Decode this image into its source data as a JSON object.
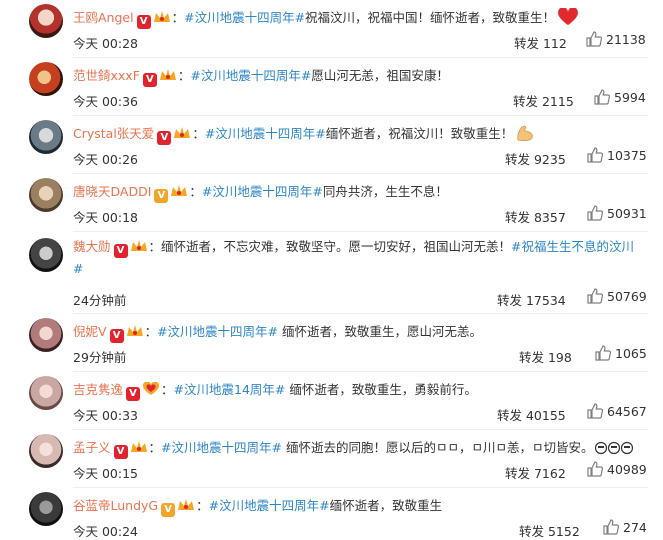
{
  "comments": [
    {
      "name": "王鸥Angel",
      "badge": "red",
      "topic": "#汶川地震十四周年#",
      "text": "祝福汶川，祝福中国！缅怀逝者，致敬重生！",
      "emoji": "heart",
      "time": "今天 00:28",
      "repost_label": "转发 112",
      "likes": "21138"
    },
    {
      "name": "范世錡xxxF",
      "badge": "red",
      "topic": "#汶川地震十四周年#",
      "text": "愿山河无恙，祖国安康！",
      "emoji": "",
      "time": "今天 00:36",
      "repost_label": "转发 2115",
      "likes": "5994"
    },
    {
      "name": "Crystal张天爱",
      "badge": "red",
      "topic": "#汶川地震十四周年#",
      "text": "缅怀逝者，祝福汶川！致敬重生！",
      "emoji": "muscle",
      "time": "今天 00:26",
      "repost_label": "转发 9235",
      "likes": "10375"
    },
    {
      "name": "唐晓天DADDI",
      "badge": "gold",
      "topic": "#汶川地震十四周年#",
      "text": "同舟共济，生生不息！",
      "emoji": "",
      "time": "今天 00:18",
      "repost_label": "转发 8357",
      "likes": "50931"
    },
    {
      "name": "魏大勋",
      "badge": "red",
      "topic": "",
      "text": "：缅怀逝者，不忘灾难，致敬坚守。愿一切安好，祖国山河无恙！",
      "topic2": "#祝福生生不息的汶川#",
      "emoji": "",
      "time": "24分钟前",
      "repost_label": "转发 17534",
      "likes": "50769"
    },
    {
      "name": "倪妮V",
      "badge": "red",
      "topic": "#汶川地震十四周年#",
      "text": " 缅怀逝者，致敬重生，愿山河无恙。",
      "emoji": "",
      "time": "29分钟前",
      "repost_label": "转发 198",
      "likes": "1065"
    },
    {
      "name": "吉克隽逸",
      "badge": "red",
      "topic": "#汶川地震14周年#",
      "text": " 缅怀逝者，致敬重生，勇毅前行。",
      "emoji": "",
      "time": "今天 00:33",
      "repost_label": "转发 40155",
      "likes": "64567"
    },
    {
      "name": "孟子义",
      "badge": "red",
      "topic": "#汶川地震十四周年#",
      "text": " 缅怀逝去的同胞！愿以后的ㅁㅁ，ㅁ川ㅁ恙，ㅁ切皆安。",
      "emoji": "pray",
      "time": "今天 00:15",
      "repost_label": "转发 7162",
      "likes": "40989"
    },
    {
      "name": "谷蓝帝LundyG",
      "badge": "gold",
      "topic": "#汶川地震十四周年#",
      "text": "缅怀逝者，致敬重生",
      "emoji": "",
      "time": "今天 00:24",
      "repost_label": "转发 5152",
      "likes": "274"
    }
  ],
  "colors": {
    "name": "#eb7350",
    "topic": "#2d86c8",
    "badge_red": "#e0232c",
    "badge_gold": "#f3a52b"
  },
  "icons": {
    "like": "thumbs-up-icon",
    "verified": "verified-v-icon",
    "crown": "crown-badge-icon"
  }
}
